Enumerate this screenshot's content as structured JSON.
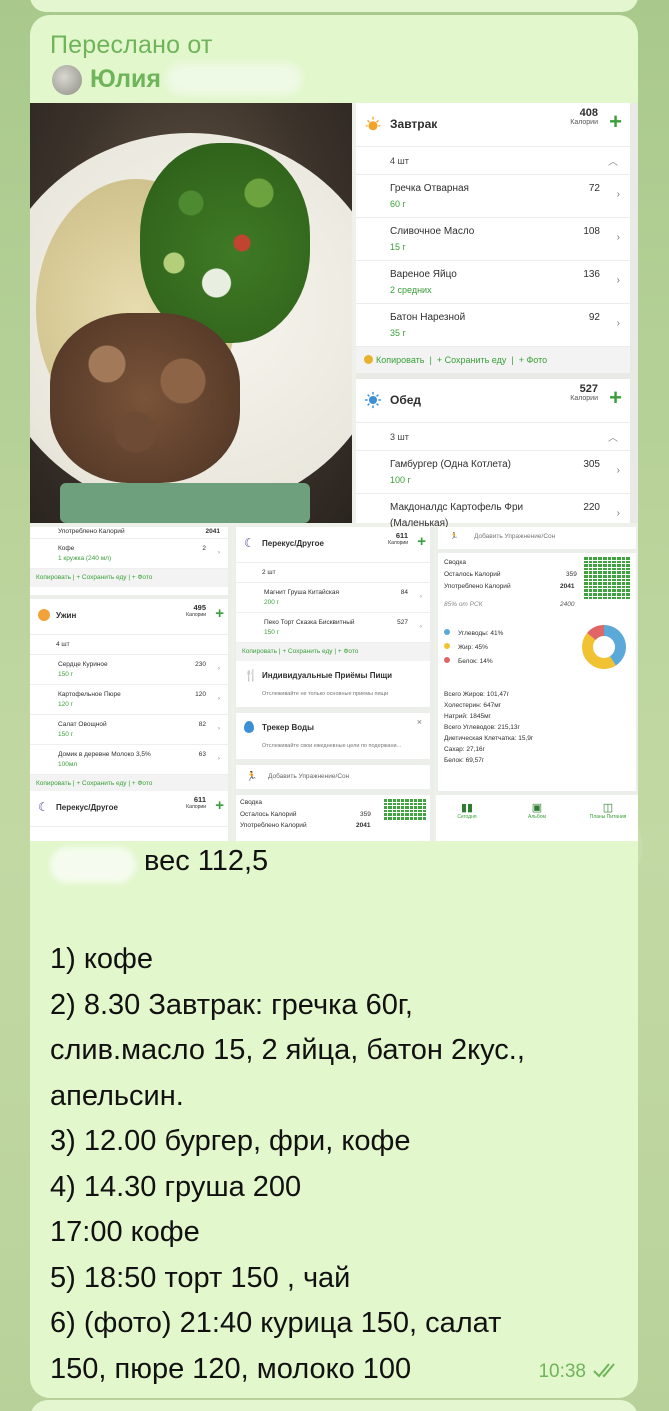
{
  "message": {
    "forwarded_label": "Переслано от",
    "sender_name": "Юлия",
    "weight_line": "вес 112,5",
    "lines": [
      "1) кофе",
      "2) 8.30 Завтрак: гречка 60г,",
      "слив.масло 15, 2 яйца, батон 2кус.,",
      "апельсин.",
      "3) 12.00 бургер, фри, кофе",
      "4) 14.30 груша 200",
      "17:00 кофе",
      "5) 18:50 торт 150 , чай",
      "6) (фото) 21:40 курица 150, салат",
      "150, пюре 120, молоко 100"
    ],
    "time": "10:38",
    "status_icon": "double-check-icon"
  },
  "breakfast": {
    "title": "Завтрак",
    "kcal": "408",
    "kcal_label": "Калории",
    "count": "4 шт",
    "items": [
      {
        "name": "Гречка Отварная",
        "sub": "60 г",
        "value": "72"
      },
      {
        "name": "Сливочное Масло",
        "sub": "15 г",
        "value": "108"
      },
      {
        "name": "Вареное Яйцо",
        "sub": "2 средних",
        "value": "136"
      },
      {
        "name": "Батон Нарезной",
        "sub": "35 г",
        "value": "92"
      }
    ],
    "actions": {
      "copy": "Копировать",
      "save": "+ Сохранить еду",
      "photo": "+ Фото"
    }
  },
  "lunch": {
    "title": "Обед",
    "kcal": "527",
    "kcal_label": "Калории",
    "count": "3 шт",
    "items": [
      {
        "name": "Гамбургер (Одна Котлета)",
        "sub": "100 г",
        "value": "305"
      },
      {
        "name": "Макдоналдс Картофель Фри",
        "sub": "(Маленькая)",
        "value": "220"
      }
    ]
  },
  "s1": {
    "consumed_label": "Употреблено Калорий",
    "consumed_value": "2041",
    "coffee_name": "Кофе",
    "coffee_sub": "1 кружка (240 мл)",
    "coffee_val": "2",
    "actions": {
      "copy": "Копировать",
      "save": "+ Сохранить еду",
      "photo": "+ Фото"
    },
    "dinner_title": "Ужин",
    "dinner_kcal": "495",
    "kcal_label": "Калории",
    "dinner_count": "4 шт",
    "dinner_items": [
      {
        "name": "Сердце Куриное",
        "sub": "150 г",
        "value": "230"
      },
      {
        "name": "Картофельное Пюре",
        "sub": "120 г",
        "value": "120"
      },
      {
        "name": "Салат Овощной",
        "sub": "150 г",
        "value": "82"
      },
      {
        "name": "Домик в деревне Молоко 3,5%",
        "sub": "100мл",
        "value": "63"
      }
    ],
    "snack_title": "Перекус/Другое",
    "snack_kcal": "611"
  },
  "s2": {
    "snack_title": "Перекус/Другое",
    "snack_kcal": "611",
    "kcal_label": "Калории",
    "snack_count": "2 шт",
    "snack_items": [
      {
        "name": "Магнит Груша Китайская",
        "sub": "200 г",
        "value": "84"
      },
      {
        "name": "Пеко Торт Сказка Бисквитный",
        "sub": "150 г",
        "value": "527"
      }
    ],
    "actions": {
      "copy": "Копировать",
      "save": "+ Сохранить еду",
      "photo": "+ Фото"
    },
    "meals_title": "Индивидуальные Приёмы Пищи",
    "meals_desc": "Отслеживайте не только основные приемы пищи",
    "water_title": "Трекер Воды",
    "water_desc": "Отслеживайте свои ежедневные цели по подержани...",
    "add_exercise": "Добавить Упражнение/Сон",
    "summary_title": "Сводка",
    "remaining_label": "Осталось Калорий",
    "remaining_value": "359",
    "consumed_label": "Употреблено Калорий",
    "consumed_value": "2041"
  },
  "s3": {
    "add_exercise": "Добавить Упражнение/Сон",
    "summary_title": "Сводка",
    "remaining_label": "Осталось Калорий",
    "remaining_value": "359",
    "consumed_label": "Употреблено Калорий",
    "consumed_value": "2041",
    "rsk_label": "85% от РСК",
    "rsk_value": "2400",
    "legend": [
      {
        "label": "Углеводы: 41%",
        "color": "#5aa9d8"
      },
      {
        "label": "Жир: 45%",
        "color": "#f1c232"
      },
      {
        "label": "Белок: 14%",
        "color": "#e06666"
      }
    ],
    "nutrients": [
      "Всего Жиров: 101,47г",
      "Холестерин: 647мг",
      "Натрий: 1845мг",
      "Всего Углеводов: 215,13г",
      "Диетическая Клетчатка: 15,9г",
      "Сахар: 27,16г",
      "Белок: 69,57г"
    ],
    "nav": [
      {
        "label": "Сегодня",
        "icon": "bar-chart-icon"
      },
      {
        "label": "Альбом",
        "icon": "image-icon"
      },
      {
        "label": "Планы Питания",
        "icon": "map-icon"
      }
    ]
  },
  "pie": {
    "carbs": 41,
    "fat": 45,
    "protein": 14
  },
  "colors": {
    "bubble": "#e2f7cc",
    "accent": "#6fb45a",
    "green": "#3a9e3a"
  }
}
